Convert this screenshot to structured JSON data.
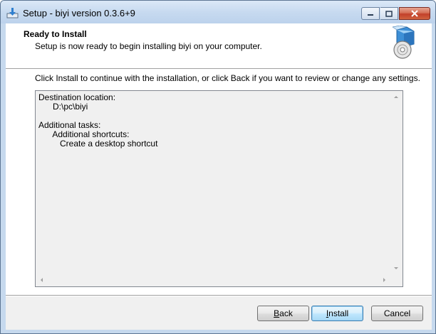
{
  "window": {
    "title": "Setup - biyi version 0.3.6+9"
  },
  "header": {
    "title": "Ready to Install",
    "subtitle": "Setup is now ready to begin installing biyi on your computer."
  },
  "intro_text": "Click Install to continue with the installation, or click Back if you want to review or change any settings.",
  "memo": {
    "lines": [
      "Destination location:",
      "      D:\\pc\\biyi",
      "",
      "Additional tasks:",
      "      Additional shortcuts:",
      "         Create a desktop shortcut"
    ]
  },
  "buttons": {
    "back": {
      "mnemonic": "B",
      "rest": "ack"
    },
    "install": {
      "mnemonic": "I",
      "rest": "nstall"
    },
    "cancel": "Cancel"
  },
  "icons": {
    "app": "setup-download-icon",
    "header": "setup-box-cd-icon"
  },
  "colors": {
    "titlebar": "#c7daf0",
    "default_button_border": "#3c7fb1",
    "memo_background": "#f0f0f0"
  }
}
